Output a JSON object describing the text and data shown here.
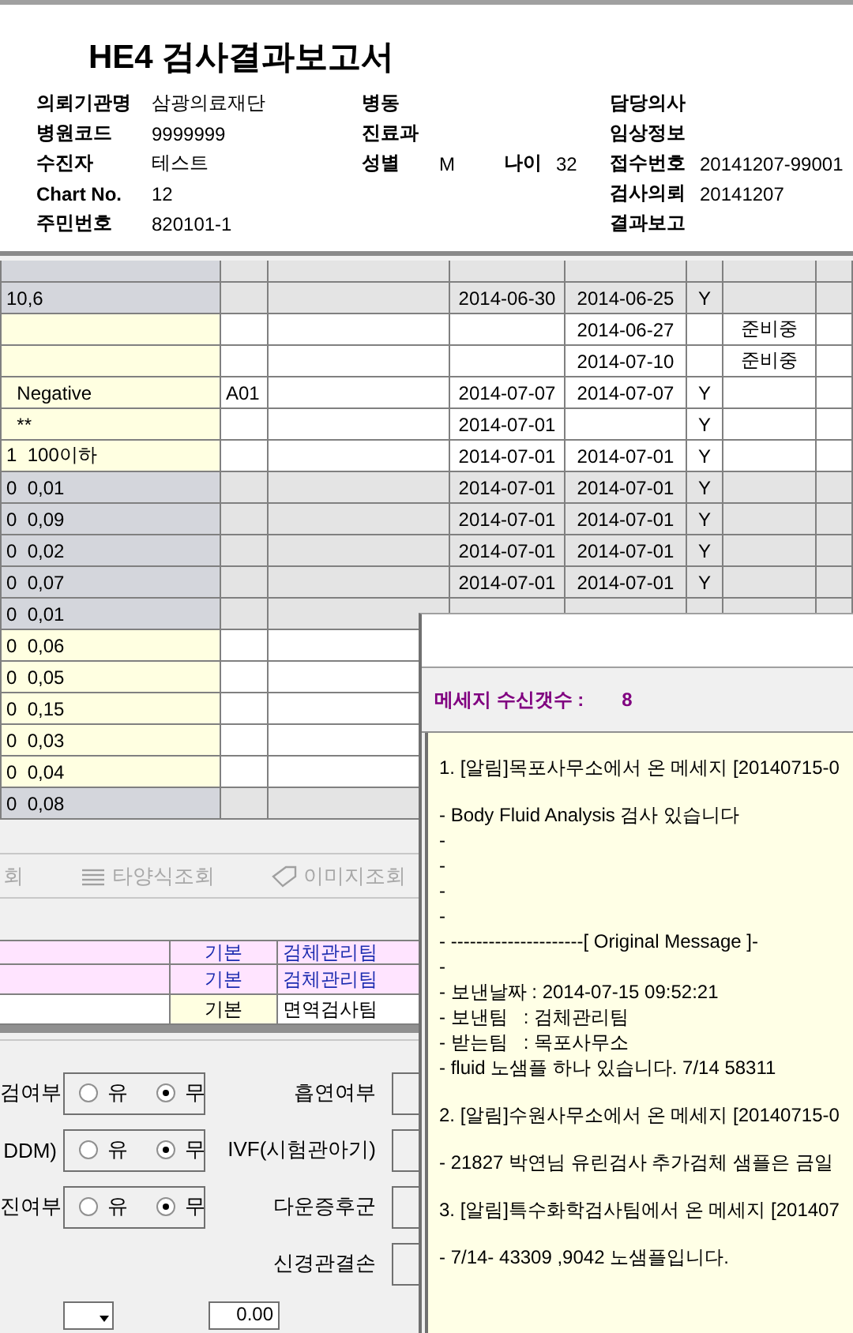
{
  "report": {
    "title": "HE4 검사결과보고서",
    "info_rows": [
      {
        "left": {
          "label": "의뢰기관명",
          "value": "삼광의료재단"
        },
        "mid": {
          "label": "병동"
        },
        "right": {
          "label": "담당의사"
        }
      },
      {
        "left": {
          "label": "병원코드",
          "value": "9999999"
        },
        "mid": {
          "label": "진료과"
        },
        "right": {
          "label": "임상정보"
        }
      },
      {
        "left": {
          "label": "수진자",
          "value": "테스트"
        },
        "mid": {
          "label": "성별",
          "value": "M"
        },
        "extra": {
          "label": "나이",
          "value": "32"
        },
        "right": {
          "label": "접수번호",
          "value": "20141207-99001"
        }
      },
      {
        "left": {
          "label": "Chart No.",
          "value": "12"
        },
        "right": {
          "label": "검사의뢰",
          "value": "20141207"
        }
      },
      {
        "left": {
          "label": "주민번호",
          "value": "820101-1"
        },
        "right": {
          "label": "결과보고"
        }
      }
    ]
  },
  "results_table": {
    "rows": [
      {
        "highlighted": false,
        "column_1": "10,6",
        "column_4": "2014-06-30",
        "column_5": "2014-06-25",
        "column_6": "Y"
      },
      {
        "highlighted": true,
        "column_5": "2014-06-27",
        "column_7": "준비중"
      },
      {
        "highlighted": true,
        "column_5": "2014-07-10",
        "column_7": "준비중"
      },
      {
        "highlighted": true,
        "column_1": "  Negative",
        "column_2": "A01",
        "column_4": "2014-07-07",
        "column_5": "2014-07-07",
        "column_6": "Y"
      },
      {
        "highlighted": true,
        "column_1": "  **",
        "column_4": "2014-07-01",
        "column_6": "Y"
      },
      {
        "highlighted": true,
        "column_1": "1  100이하",
        "column_4": "2014-07-01",
        "column_5": "2014-07-01",
        "column_6": "Y"
      },
      {
        "highlighted": false,
        "column_1": "0  0,01",
        "column_4": "2014-07-01",
        "column_5": "2014-07-01",
        "column_6": "Y"
      },
      {
        "highlighted": false,
        "column_1": "0  0,09",
        "column_4": "2014-07-01",
        "column_5": "2014-07-01",
        "column_6": "Y"
      },
      {
        "highlighted": false,
        "column_1": "0  0,02",
        "column_4": "2014-07-01",
        "column_5": "2014-07-01",
        "column_6": "Y"
      },
      {
        "highlighted": false,
        "column_1": "0  0,07",
        "column_4": "2014-07-01",
        "column_5": "2014-07-01",
        "column_6": "Y"
      },
      {
        "highlighted": false,
        "column_1": "0  0,01"
      },
      {
        "highlighted": true,
        "column_1": "0  0,06"
      },
      {
        "highlighted": true,
        "column_1": "0  0,05"
      },
      {
        "highlighted": true,
        "column_1": "0  0,15"
      },
      {
        "highlighted": true,
        "column_1": "0  0,03"
      },
      {
        "highlighted": true,
        "column_1": "0  0,04"
      },
      {
        "highlighted": false,
        "column_1": "0  0,08"
      }
    ]
  },
  "toolbar": [
    {
      "label": "회",
      "kind": "plain",
      "disabled": true
    },
    {
      "label": "타양식조회",
      "kind": "list",
      "disabled": true
    },
    {
      "label": "이미지조회",
      "kind": "tag",
      "disabled": true
    }
  ],
  "team_table": {
    "rows": [
      {
        "highlighted": true,
        "type": "기본",
        "team": "검체관리팀"
      },
      {
        "highlighted": true,
        "type": "기본",
        "team": "검체관리팀"
      },
      {
        "highlighted": false,
        "type": "기본",
        "team": "면역검사팀"
      }
    ]
  },
  "conditions": [
    {
      "label": "검여부",
      "options": [
        {
          "label": "유",
          "selected": false
        },
        {
          "label": "무",
          "selected": true
        }
      ],
      "right_label": "흡연여부"
    },
    {
      "label": "DDM)",
      "options": [
        {
          "label": "유",
          "selected": false
        },
        {
          "label": "무",
          "selected": true
        }
      ],
      "right_label": "IVF(시험관아기)"
    },
    {
      "label": "진여부",
      "options": [
        {
          "label": "유",
          "selected": false
        },
        {
          "label": "무",
          "selected": true
        }
      ],
      "right_label": "다운증후군"
    },
    {
      "right_label": "신경관결손"
    }
  ],
  "bottom_row": {
    "weight_value": "0.00"
  },
  "message_popup": {
    "count_label": "메세지 수신갯수 :",
    "count": "8",
    "paragraphs": [
      [
        "1. [알림]목포사무소에서 온 메세지 [20140715-0"
      ],
      [
        "- Body Fluid Analysis 검사 있습니다",
        "-",
        "-",
        "-",
        "-",
        "- ---------------------[ Original Message ]-",
        "-",
        "- 보낸날짜 : 2014-07-15 09:52:21",
        "- 보낸팀   : 검체관리팀",
        "- 받는팀   : 목포사무소",
        "- fluid 노샘플 하나 있습니다. 7/14 58311"
      ],
      [
        "2. [알림]수원사무소에서 온 메세지 [20140715-0"
      ],
      [
        "- 21827 박연님 유린검사 추가검체 샘플은 금일"
      ],
      [
        "3. [알림]특수화학검사팀에서 온 메세지 [201407"
      ],
      [
        "- 7/14- 43309 ,9042 노샘플입니다."
      ]
    ]
  }
}
